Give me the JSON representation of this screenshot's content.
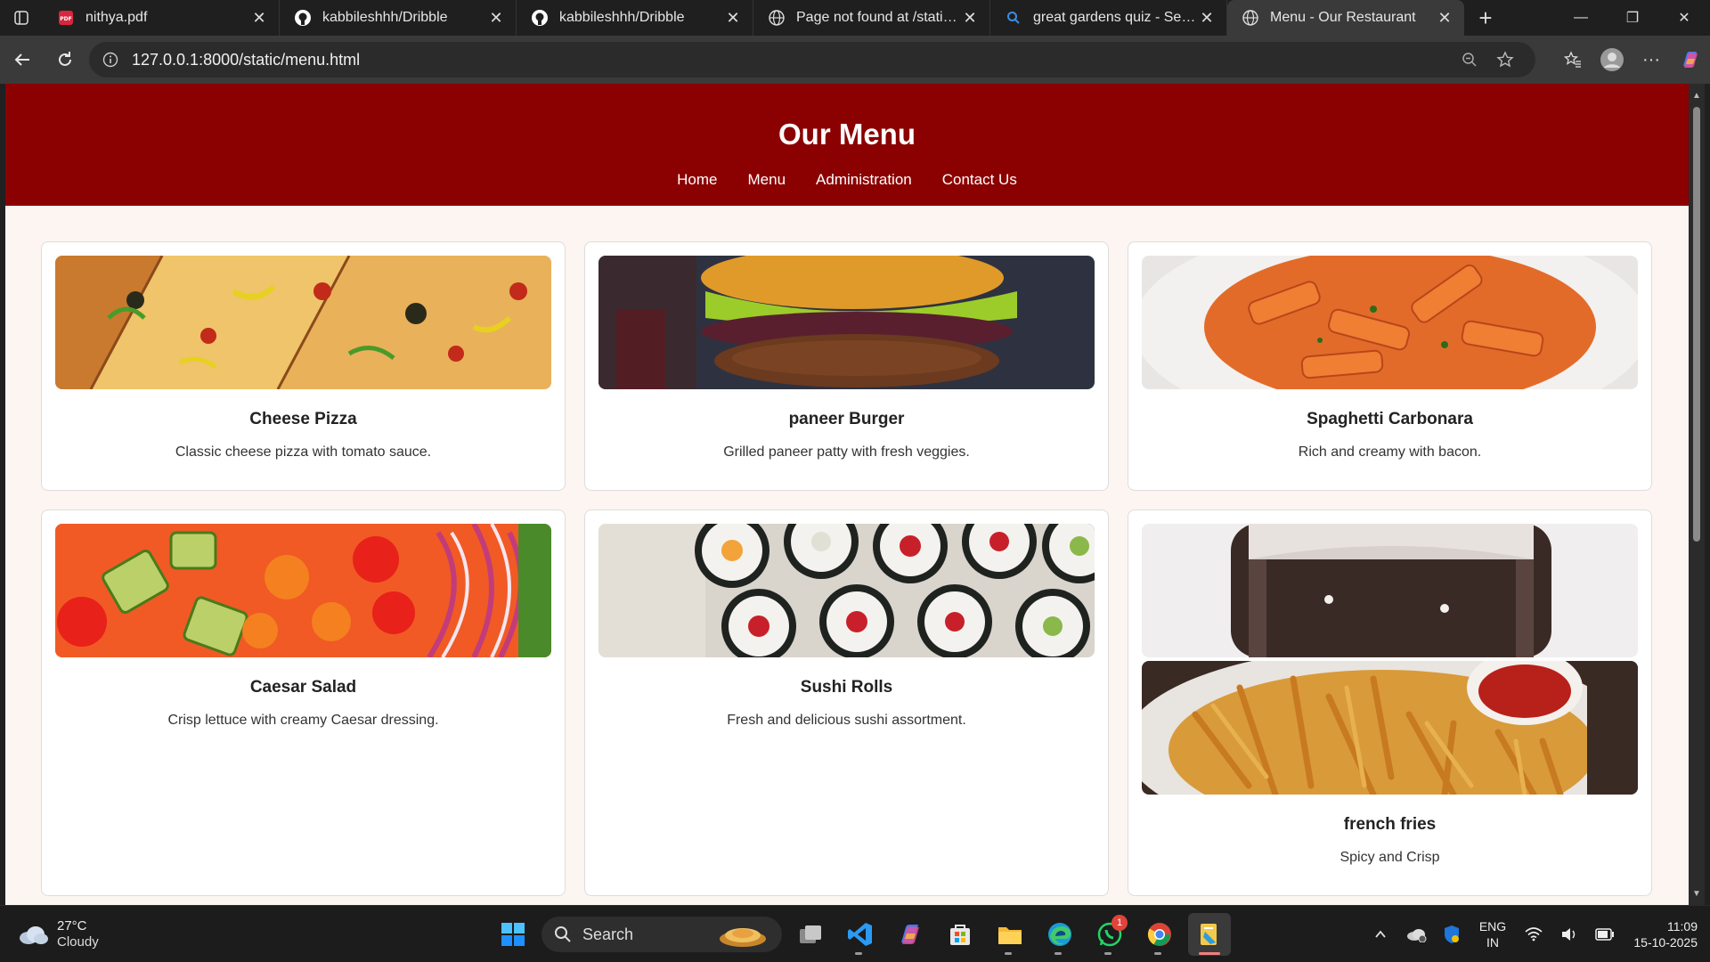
{
  "browser": {
    "tabs": [
      {
        "title": "nithya.pdf",
        "icon": "pdf-icon"
      },
      {
        "title": "kabbileshhh/Dribble",
        "icon": "github-icon"
      },
      {
        "title": "kabbileshhh/Dribble",
        "icon": "github-icon"
      },
      {
        "title": "Page not found at /static/ho",
        "icon": "globe-icon"
      },
      {
        "title": "great gardens quiz - Search",
        "icon": "search-icon"
      },
      {
        "title": "Menu - Our Restaurant",
        "icon": "globe-icon",
        "active": true
      }
    ],
    "url": "127.0.0.1:8000/static/menu.html"
  },
  "page": {
    "title": "Our Menu",
    "nav": [
      "Home",
      "Menu",
      "Administration",
      "Contact Us"
    ],
    "items": [
      {
        "name": "Cheese Pizza",
        "desc": "Classic cheese pizza with tomato sauce."
      },
      {
        "name": "paneer Burger",
        "desc": "Grilled paneer patty with fresh veggies."
      },
      {
        "name": "Spaghetti Carbonara",
        "desc": "Rich and creamy with bacon."
      },
      {
        "name": "Caesar Salad",
        "desc": "Crisp lettuce with creamy Caesar dressing."
      },
      {
        "name": "Sushi Rolls",
        "desc": "Fresh and delicious sushi assortment."
      },
      {
        "name": "french fries",
        "desc": "Spicy and Crisp"
      }
    ],
    "colors": {
      "header": "#8b0000",
      "background": "#fcf5f1"
    }
  },
  "taskbar": {
    "weather_temp": "27°C",
    "weather_desc": "Cloudy",
    "search_label": "Search",
    "lang_line1": "ENG",
    "lang_line2": "IN",
    "time": "11:09",
    "date": "15-10-2025",
    "whatsapp_badge": "1"
  }
}
